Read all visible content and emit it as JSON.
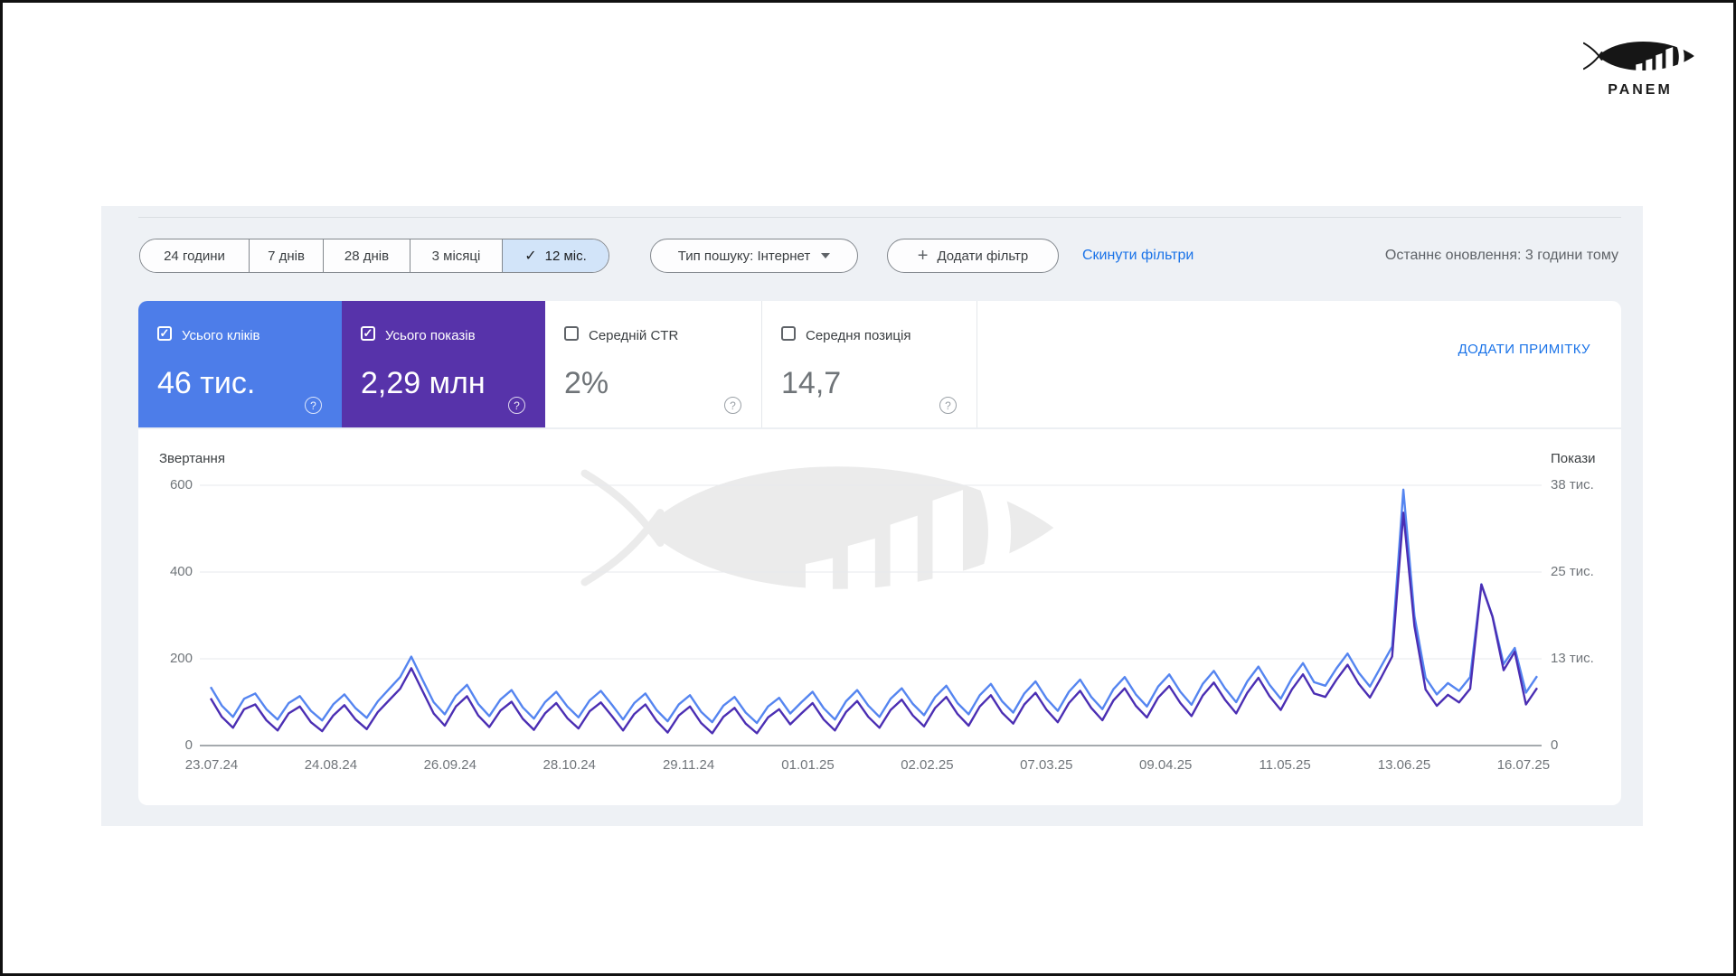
{
  "logo": {
    "brand": "PANEM"
  },
  "filters": {
    "time_ranges": [
      {
        "label": "24 години",
        "selected": false
      },
      {
        "label": "7 днів",
        "selected": false
      },
      {
        "label": "28 днів",
        "selected": false
      },
      {
        "label": "3 місяці",
        "selected": false
      },
      {
        "label": "12 міс.",
        "selected": true
      }
    ],
    "search_type": "Тип пошуку: Інтернет",
    "add_filter": "Додати фільтр",
    "reset_filters": "Скинути фільтри",
    "last_update": "Останнє оновлення: 3 години тому"
  },
  "metrics": {
    "cards": [
      {
        "label": "Усього кліків",
        "value": "46 тис.",
        "checked": true,
        "accent": "#4d7de9"
      },
      {
        "label": "Усього показів",
        "value": "2,29 млн",
        "checked": true,
        "accent": "#5733aa"
      },
      {
        "label": "Середній CTR",
        "value": "2%",
        "checked": false,
        "accent": "#ffffff"
      },
      {
        "label": "Середня позиція",
        "value": "14,7",
        "checked": false,
        "accent": "#ffffff"
      }
    ],
    "annotation_link": "ДОДАТИ ПРИМІТКУ"
  },
  "chart_data": {
    "type": "line",
    "grid": "horizontal",
    "x_tick_labels": [
      "23.07.24",
      "24.08.24",
      "26.09.24",
      "28.10.24",
      "29.11.24",
      "01.01.25",
      "02.02.25",
      "07.03.25",
      "09.04.25",
      "11.05.25",
      "13.06.25",
      "16.07.25"
    ],
    "left_axis": {
      "title": "Звертання",
      "ticks": [
        "0",
        "200",
        "400",
        "600"
      ],
      "range": [
        0,
        600
      ]
    },
    "right_axis": {
      "title": "Покази",
      "ticks": [
        "0",
        "13 тис.",
        "25 тис.",
        "38 тис."
      ],
      "range": [
        0,
        38000
      ]
    },
    "series": [
      {
        "name": "Усього кліків",
        "axis": "left",
        "color": "#5585f0",
        "values": [
          135,
          92,
          66,
          108,
          120,
          84,
          60,
          98,
          114,
          80,
          58,
          95,
          118,
          86,
          64,
          102,
          130,
          158,
          205,
          152,
          100,
          72,
          115,
          140,
          96,
          68,
          106,
          128,
          88,
          62,
          100,
          124,
          90,
          65,
          104,
          126,
          94,
          60,
          98,
          120,
          82,
          56,
          95,
          116,
          78,
          54,
          92,
          112,
          76,
          52,
          90,
          110,
          74,
          100,
          124,
          86,
          60,
          102,
          128,
          92,
          66,
          108,
          132,
          96,
          70,
          112,
          138,
          98,
          72,
          116,
          142,
          102,
          76,
          120,
          148,
          108,
          80,
          124,
          152,
          112,
          84,
          130,
          158,
          118,
          90,
          136,
          164,
          124,
          94,
          142,
          172,
          132,
          100,
          148,
          182,
          140,
          108,
          155,
          190,
          146,
          138,
          178,
          212,
          168,
          136,
          182,
          228,
          590,
          298,
          156,
          118,
          144,
          126,
          158,
          372,
          298,
          188,
          225,
          122,
          160
        ]
      },
      {
        "name": "Усього показів",
        "axis": "right",
        "color": "#4b2eb3",
        "values": [
          6900,
          4200,
          2600,
          5300,
          6000,
          3700,
          2200,
          4700,
          5700,
          3400,
          2100,
          4400,
          5900,
          3800,
          2400,
          4900,
          6600,
          8300,
          11300,
          8000,
          4700,
          2900,
          5700,
          7200,
          4400,
          2700,
          5100,
          6400,
          3900,
          2300,
          4700,
          6200,
          4000,
          2500,
          5000,
          6300,
          4300,
          2200,
          4600,
          6000,
          3600,
          1900,
          4400,
          5700,
          3300,
          1800,
          4200,
          5500,
          3200,
          1800,
          4100,
          5300,
          3100,
          4700,
          6200,
          3800,
          2200,
          4900,
          6500,
          4200,
          2600,
          5200,
          6700,
          4400,
          2800,
          5500,
          7100,
          4600,
          2900,
          5700,
          7350,
          4800,
          3200,
          6000,
          7700,
          5200,
          3400,
          6200,
          8000,
          5500,
          3700,
          6600,
          8350,
          5800,
          4100,
          7000,
          8700,
          6200,
          4300,
          7300,
          9200,
          6700,
          4700,
          7700,
          9900,
          7200,
          5200,
          8200,
          10400,
          7600,
          7100,
          9600,
          11800,
          9000,
          7000,
          9900,
          13000,
          34000,
          17400,
          8200,
          5800,
          7400,
          6300,
          8300,
          23500,
          18800,
          11000,
          13700,
          6000,
          8400
        ]
      }
    ]
  }
}
